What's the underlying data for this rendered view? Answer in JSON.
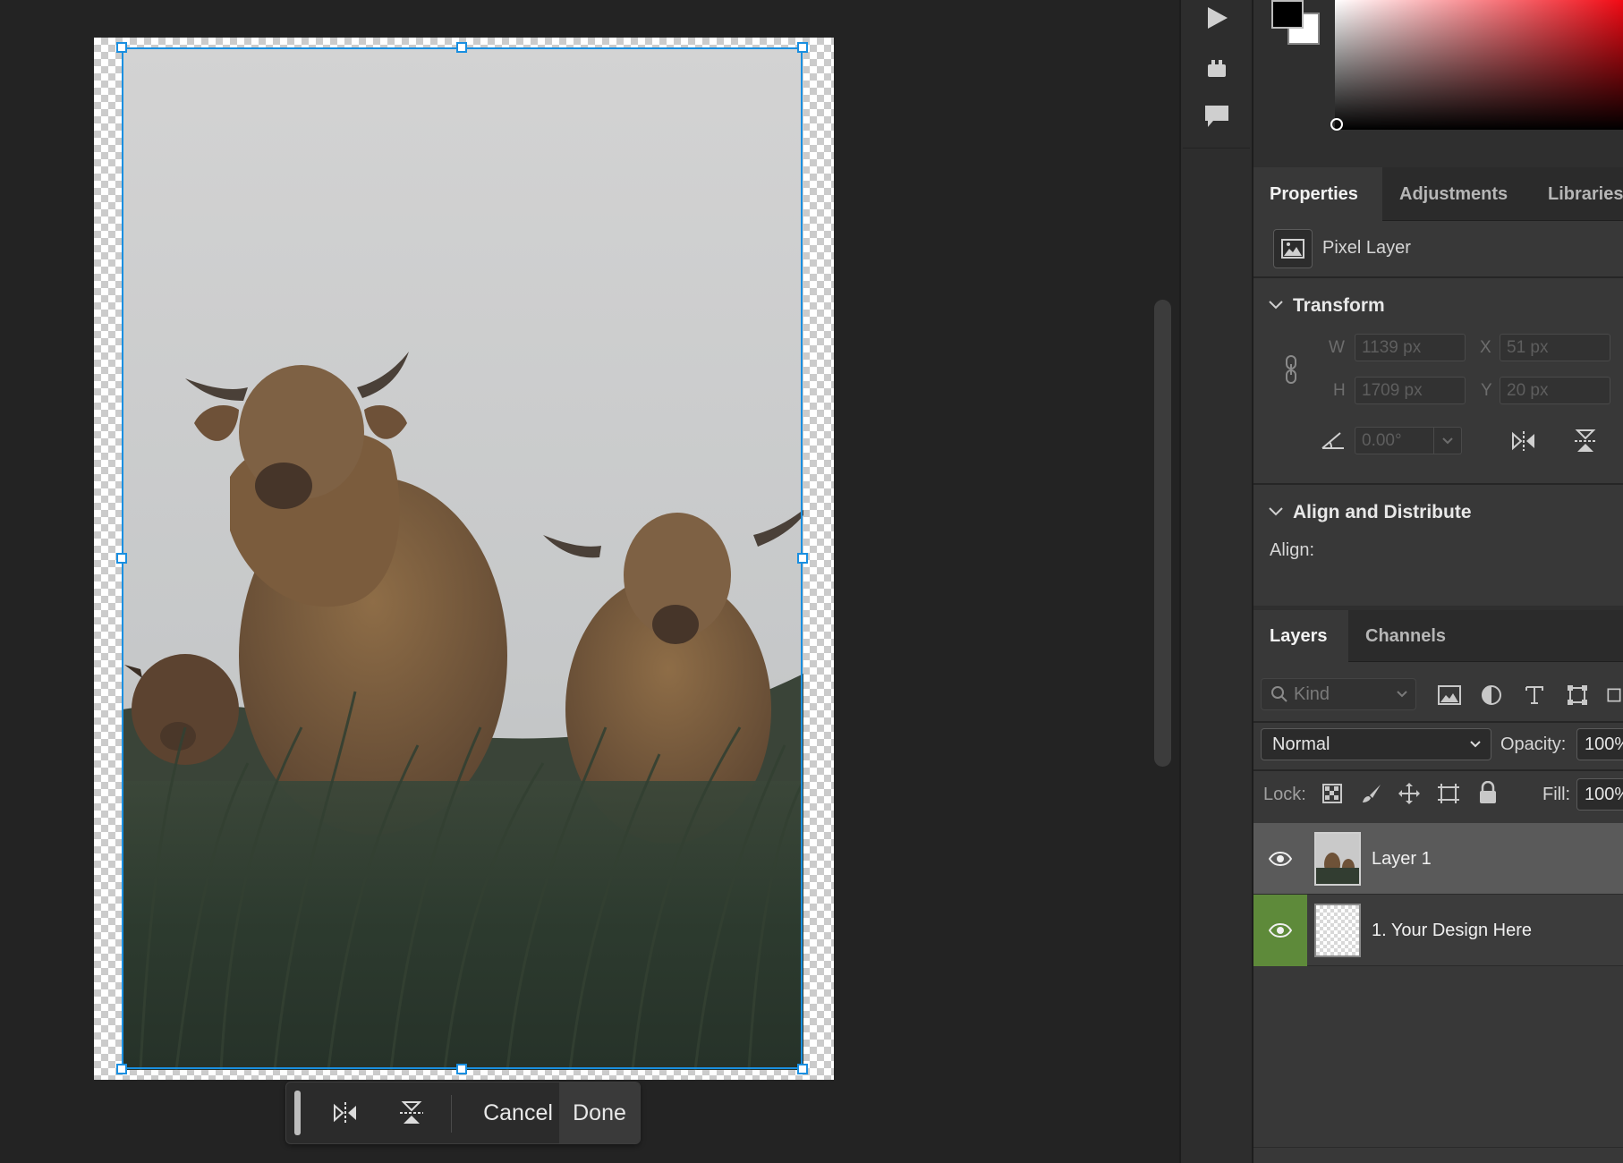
{
  "canvas": {
    "taskbar": {
      "cancel_label": "Cancel",
      "done_label": "Done"
    }
  },
  "properties_panel": {
    "tabs": [
      "Properties",
      "Adjustments",
      "Libraries"
    ],
    "layer_kind": "Pixel Layer",
    "transform": {
      "title": "Transform",
      "w_label": "W",
      "w_value": "1139 px",
      "h_label": "H",
      "h_value": "1709 px",
      "x_label": "X",
      "x_value": "51 px",
      "y_label": "Y",
      "y_value": "20 px",
      "angle_value": "0.00°"
    },
    "align": {
      "title": "Align and Distribute",
      "align_label": "Align:"
    }
  },
  "layers_panel": {
    "tabs": [
      "Layers",
      "Channels"
    ],
    "filter_placeholder": "Kind",
    "blend_mode": "Normal",
    "opacity_label": "Opacity:",
    "opacity_value": "100%",
    "lock_label": "Lock:",
    "fill_label": "Fill:",
    "fill_value": "100%",
    "layers": [
      {
        "name": "Layer 1",
        "selected": true
      },
      {
        "name": "1. Your Design Here",
        "selected": false
      }
    ]
  },
  "colors": {
    "selection": "#1a8fe0",
    "eye_active_bg": "#5e8a3a",
    "panel_bg": "#383838"
  }
}
